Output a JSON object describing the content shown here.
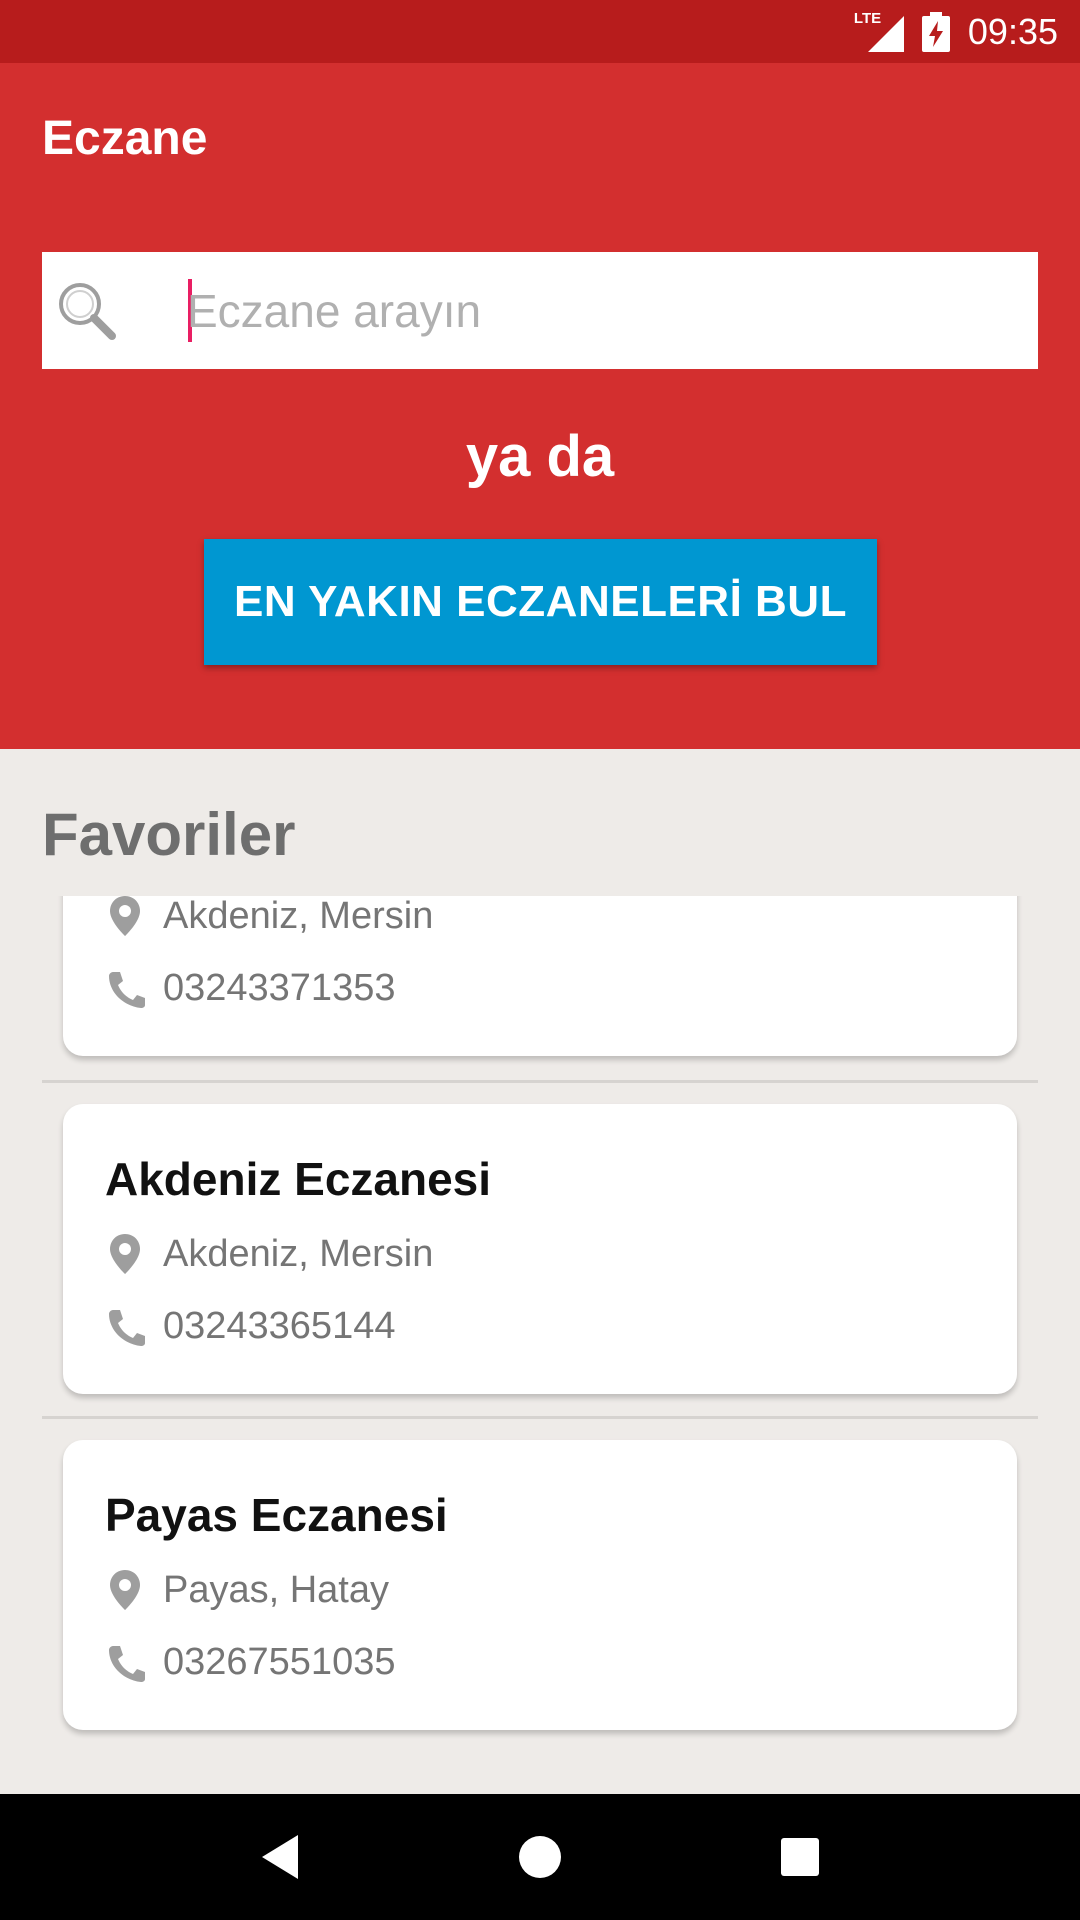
{
  "status": {
    "time": "09:35",
    "network": "LTE"
  },
  "app": {
    "title": "Eczane"
  },
  "search": {
    "placeholder": "Eczane arayın",
    "value": ""
  },
  "or_text": "ya da",
  "find_button": {
    "label": "EN YAKIN ECZANELERİ BUL"
  },
  "favorites": {
    "title": "Favoriler",
    "items": [
      {
        "name": "",
        "location": "Akdeniz, Mersin",
        "phone": "03243371353"
      },
      {
        "name": "Akdeniz Eczanesi",
        "location": "Akdeniz, Mersin",
        "phone": "03243365144"
      },
      {
        "name": "Payas Eczanesi",
        "location": "Payas, Hatay",
        "phone": "03267551035"
      }
    ]
  },
  "colors": {
    "status_bar": "#b71c1c",
    "header": "#d32f2f",
    "button": "#0097d1",
    "caret": "#e91e63"
  },
  "icons": [
    "search-icon",
    "location-pin-icon",
    "phone-icon",
    "back-icon",
    "home-icon",
    "recents-icon"
  ]
}
